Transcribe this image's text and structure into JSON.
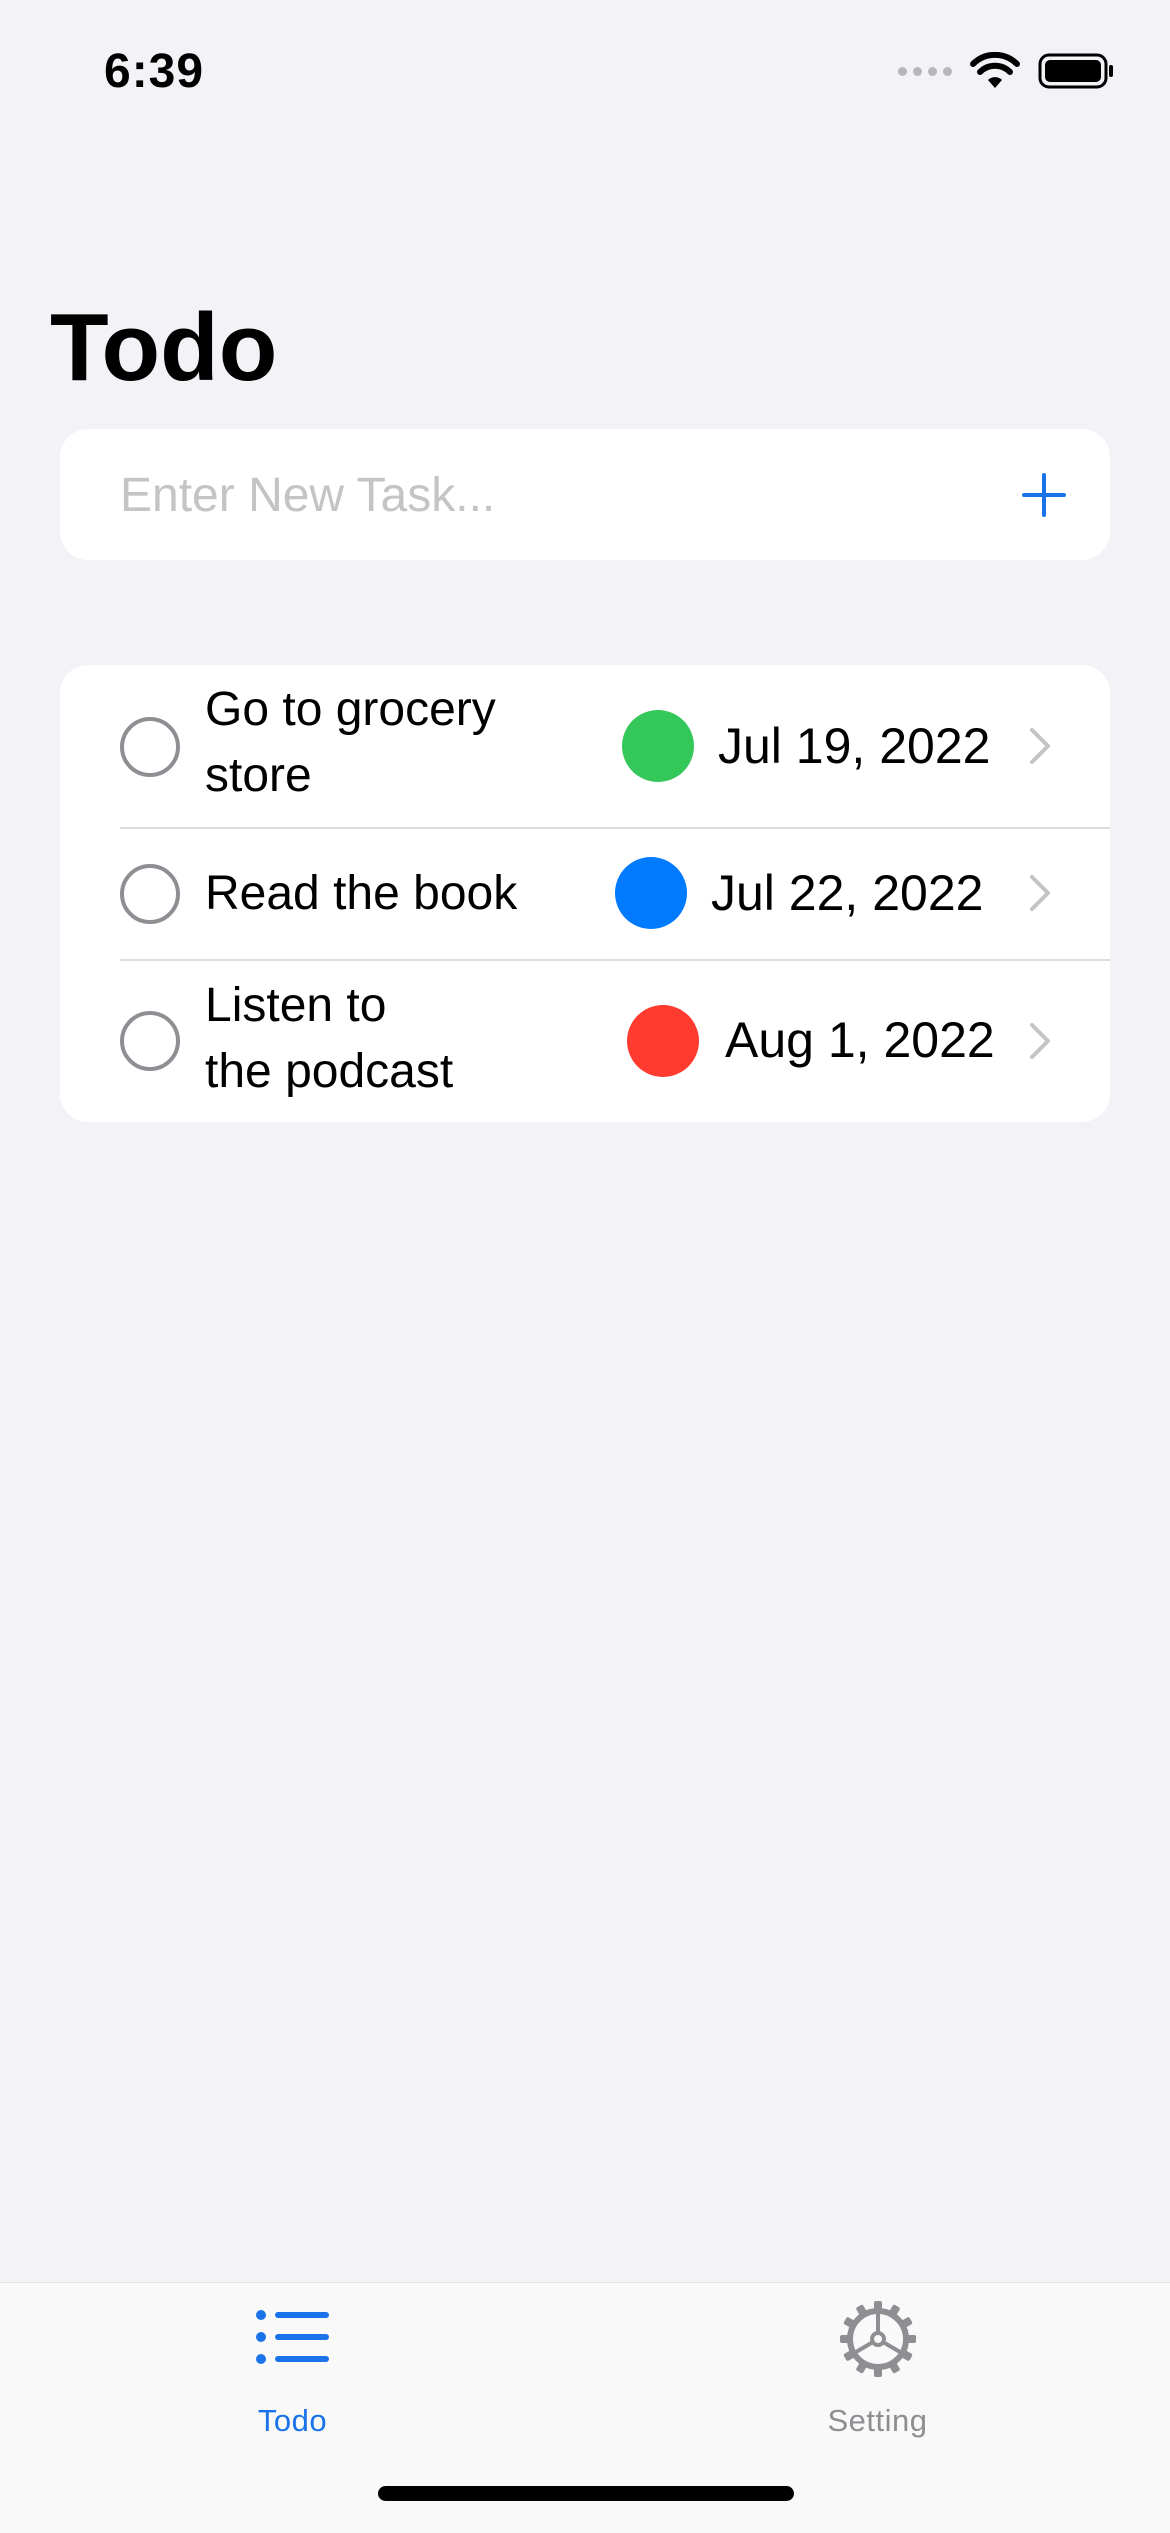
{
  "status_bar": {
    "time": "6:39"
  },
  "header": {
    "title": "Todo"
  },
  "new_task": {
    "placeholder": "Enter New Task...",
    "value": "",
    "add_icon": "plus-icon"
  },
  "tasks": [
    {
      "title_line1": "Go to grocery",
      "title_line2": "store",
      "date": "Jul 19, 2022",
      "priority_color": "#34c759",
      "completed": false
    },
    {
      "title_line1": "Read the book",
      "title_line2": "",
      "date": "Jul 22, 2022",
      "priority_color": "#007aff",
      "completed": false
    },
    {
      "title_line1": "Listen to",
      "title_line2": "the podcast",
      "date": "Aug 1, 2022",
      "priority_color": "#ff3b30",
      "completed": false
    }
  ],
  "tab_bar": {
    "tabs": [
      {
        "label": "Todo",
        "icon": "list-icon",
        "selected": true
      },
      {
        "label": "Setting",
        "icon": "gear-icon",
        "selected": false
      }
    ]
  },
  "colors": {
    "accent": "#1a73e8",
    "background": "#f2f2f7",
    "inactive_tab": "#8e8e93"
  }
}
